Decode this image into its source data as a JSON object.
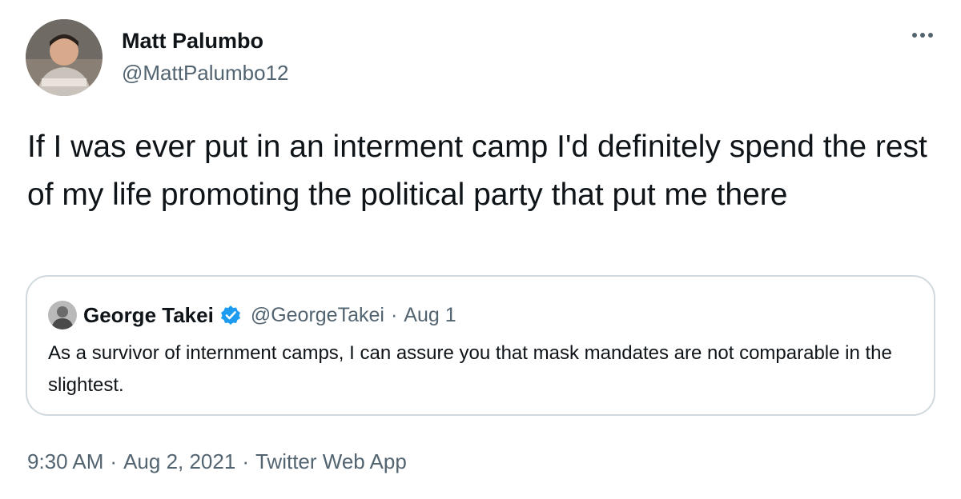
{
  "author": {
    "display_name": "Matt Palumbo",
    "handle": "@MattPalumbo12",
    "avatar_icon": "profile-photo"
  },
  "tweet": {
    "text": "If I was ever put in an interment camp I'd definitely spend the rest of my life promoting the political party that put me there",
    "more_icon": "ellipsis-icon"
  },
  "quoted_tweet": {
    "display_name": "George Takei",
    "verified": true,
    "verified_color": "#1d9bf0",
    "handle": "@GeorgeTakei",
    "separator": "·",
    "date": "Aug 1",
    "text": "As a survivor of internment camps, I can assure you that mask mandates are not comparable in the slightest."
  },
  "meta": {
    "time": "9:30 AM",
    "separator": "·",
    "date": "Aug 2, 2021",
    "source": "Twitter Web App"
  },
  "colors": {
    "text_primary": "#0f1419",
    "text_secondary": "#536471",
    "border": "#cfd9de"
  }
}
